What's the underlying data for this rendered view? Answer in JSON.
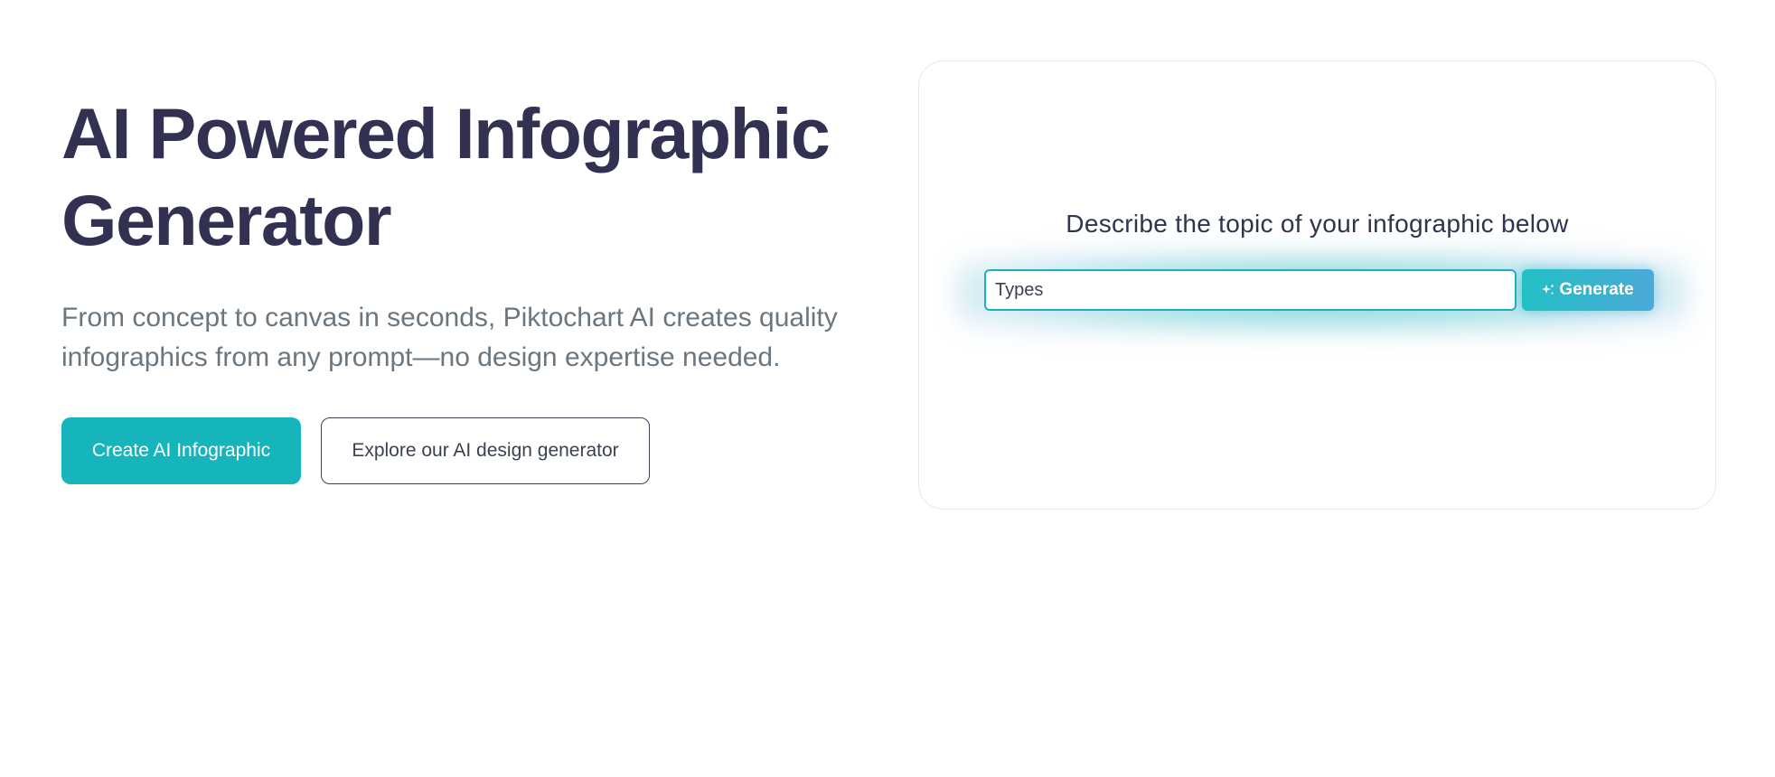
{
  "hero": {
    "title": "AI Powered Infographic Generator",
    "subtitle": "From concept to canvas in seconds, Piktochart AI creates quality infographics from any prompt—no design expertise needed.",
    "primary_button": "Create AI Infographic",
    "secondary_button": "Explore our AI design generator"
  },
  "generator": {
    "prompt_label": "Describe the topic of your infographic below",
    "input_placeholder": "Types",
    "generate_button": "Generate",
    "generate_icon": "sparkle-icon"
  },
  "colors": {
    "title": "#323152",
    "subtitle": "#6a7781",
    "accent": "#16b5bb",
    "generate_gradient_end": "#4aa9d8"
  }
}
